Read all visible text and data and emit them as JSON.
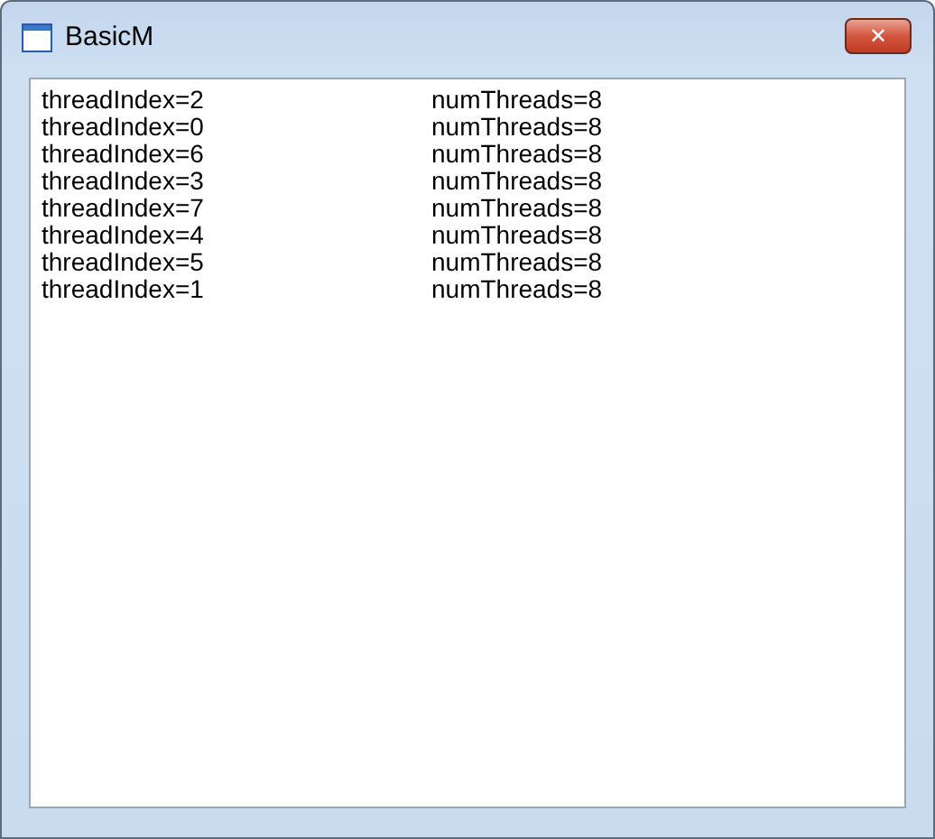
{
  "window": {
    "title": "BasicM",
    "close_label": "✕"
  },
  "list": {
    "rows": [
      {
        "column_1": "threadIndex=2",
        "column_2": "numThreads=8"
      },
      {
        "column_1": "threadIndex=0",
        "column_2": "numThreads=8"
      },
      {
        "column_1": "threadIndex=6",
        "column_2": "numThreads=8"
      },
      {
        "column_1": "threadIndex=3",
        "column_2": "numThreads=8"
      },
      {
        "column_1": "threadIndex=7",
        "column_2": "numThreads=8"
      },
      {
        "column_1": "threadIndex=4",
        "column_2": "numThreads=8"
      },
      {
        "column_1": "threadIndex=5",
        "column_2": "numThreads=8"
      },
      {
        "column_1": "threadIndex=1",
        "column_2": "numThreads=8"
      }
    ]
  }
}
